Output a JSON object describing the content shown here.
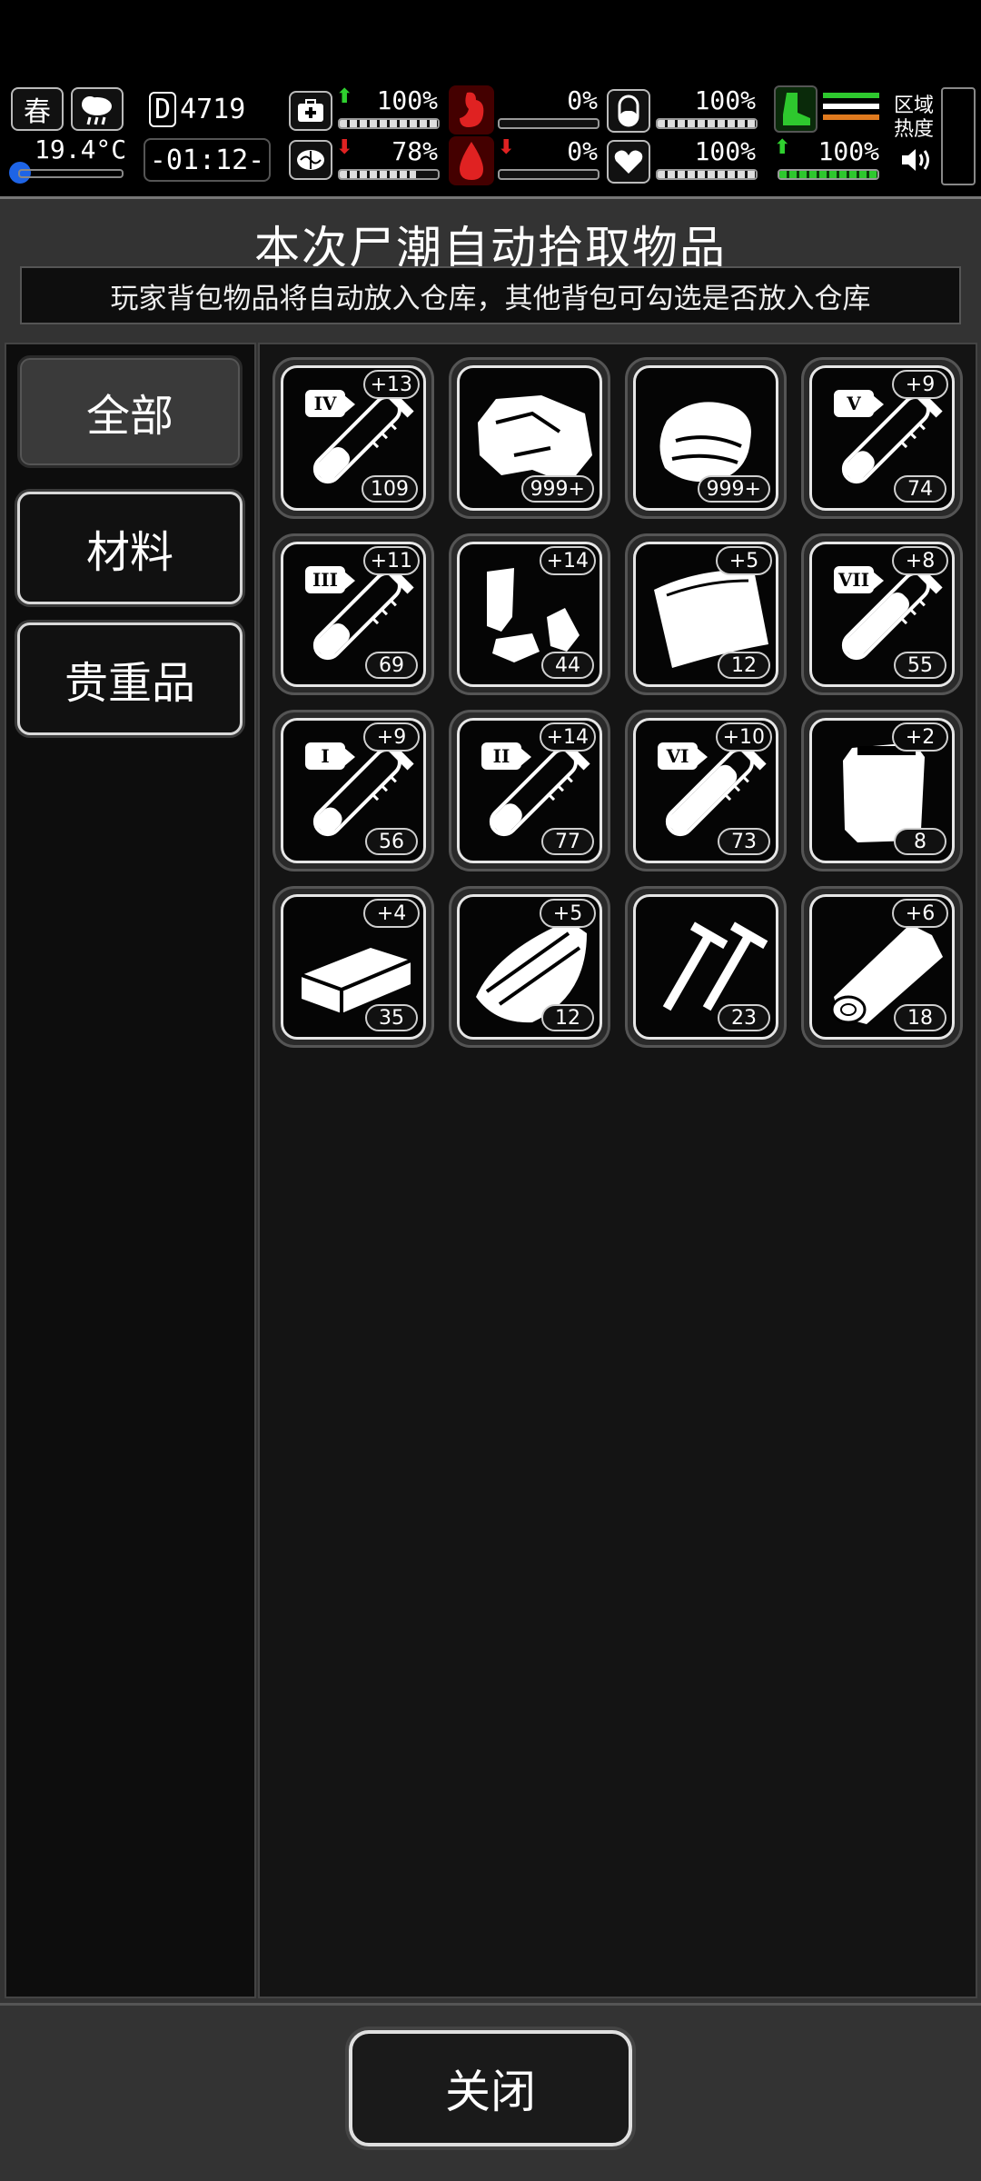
{
  "status": {
    "season": "春",
    "temperature": "19.4°C",
    "day_counter": "4719",
    "day_prefix": "D",
    "time": "-01:12-",
    "health_pct": "100%",
    "brain_pct": "78%",
    "hunger_pct": "0%",
    "blood_pct": "0%",
    "pill_pct": "100%",
    "heart_pct": "100%",
    "stamina_pct": "100%",
    "health_fill": 1.0,
    "brain_fill": 0.78,
    "hunger_fill": 0,
    "blood_fill": 0,
    "pill_fill": 1.0,
    "heart_fill": 1.0,
    "stamina_fill": 1.0,
    "area_label": "区域\n热度",
    "area_label_line1": "区域",
    "area_label_line2": "热度"
  },
  "panel": {
    "title": "本次尸潮自动拾取物品",
    "subtitle": "玩家背包物品将自动放入仓库，其他背包可勾选是否放入仓库"
  },
  "categories": [
    {
      "label": "全部",
      "active": true
    },
    {
      "label": "材料",
      "active": false
    },
    {
      "label": "贵重品",
      "active": false
    }
  ],
  "items": [
    {
      "icon": "test-tube-icon",
      "tier": "IV",
      "bonus": "+13",
      "count": "109",
      "fill": 0.35
    },
    {
      "icon": "meat-chunk-icon",
      "tier": "",
      "bonus": "",
      "count": "999+"
    },
    {
      "icon": "cloth-icon",
      "tier": "",
      "bonus": "",
      "count": "999+"
    },
    {
      "icon": "test-tube-icon",
      "tier": "V",
      "bonus": "+9",
      "count": "74",
      "fill": 0.3
    },
    {
      "icon": "test-tube-icon",
      "tier": "III",
      "bonus": "+11",
      "count": "69",
      "fill": 0.35
    },
    {
      "icon": "scrap-parts-icon",
      "tier": "",
      "bonus": "+14",
      "count": "44"
    },
    {
      "icon": "plastic-sheet-icon",
      "tier": "",
      "bonus": "+5",
      "count": "12"
    },
    {
      "icon": "test-tube-icon",
      "tier": "VII",
      "bonus": "+8",
      "count": "55",
      "fill": 0.75
    },
    {
      "icon": "test-tube-icon",
      "tier": "I",
      "bonus": "+9",
      "count": "56",
      "fill": 0.25
    },
    {
      "icon": "test-tube-icon",
      "tier": "II",
      "bonus": "+14",
      "count": "77",
      "fill": 0.3
    },
    {
      "icon": "test-tube-icon",
      "tier": "VI",
      "bonus": "+10",
      "count": "73",
      "fill": 0.8
    },
    {
      "icon": "plastic-bag-icon",
      "tier": "",
      "bonus": "+2",
      "count": "8"
    },
    {
      "icon": "brick-icon",
      "tier": "",
      "bonus": "+4",
      "count": "35"
    },
    {
      "icon": "wood-planks-icon",
      "tier": "",
      "bonus": "+5",
      "count": "12"
    },
    {
      "icon": "nails-icon",
      "tier": "",
      "bonus": "",
      "count": "23"
    },
    {
      "icon": "log-icon",
      "tier": "",
      "bonus": "+6",
      "count": "18"
    }
  ],
  "footer": {
    "close_label": "关闭"
  }
}
